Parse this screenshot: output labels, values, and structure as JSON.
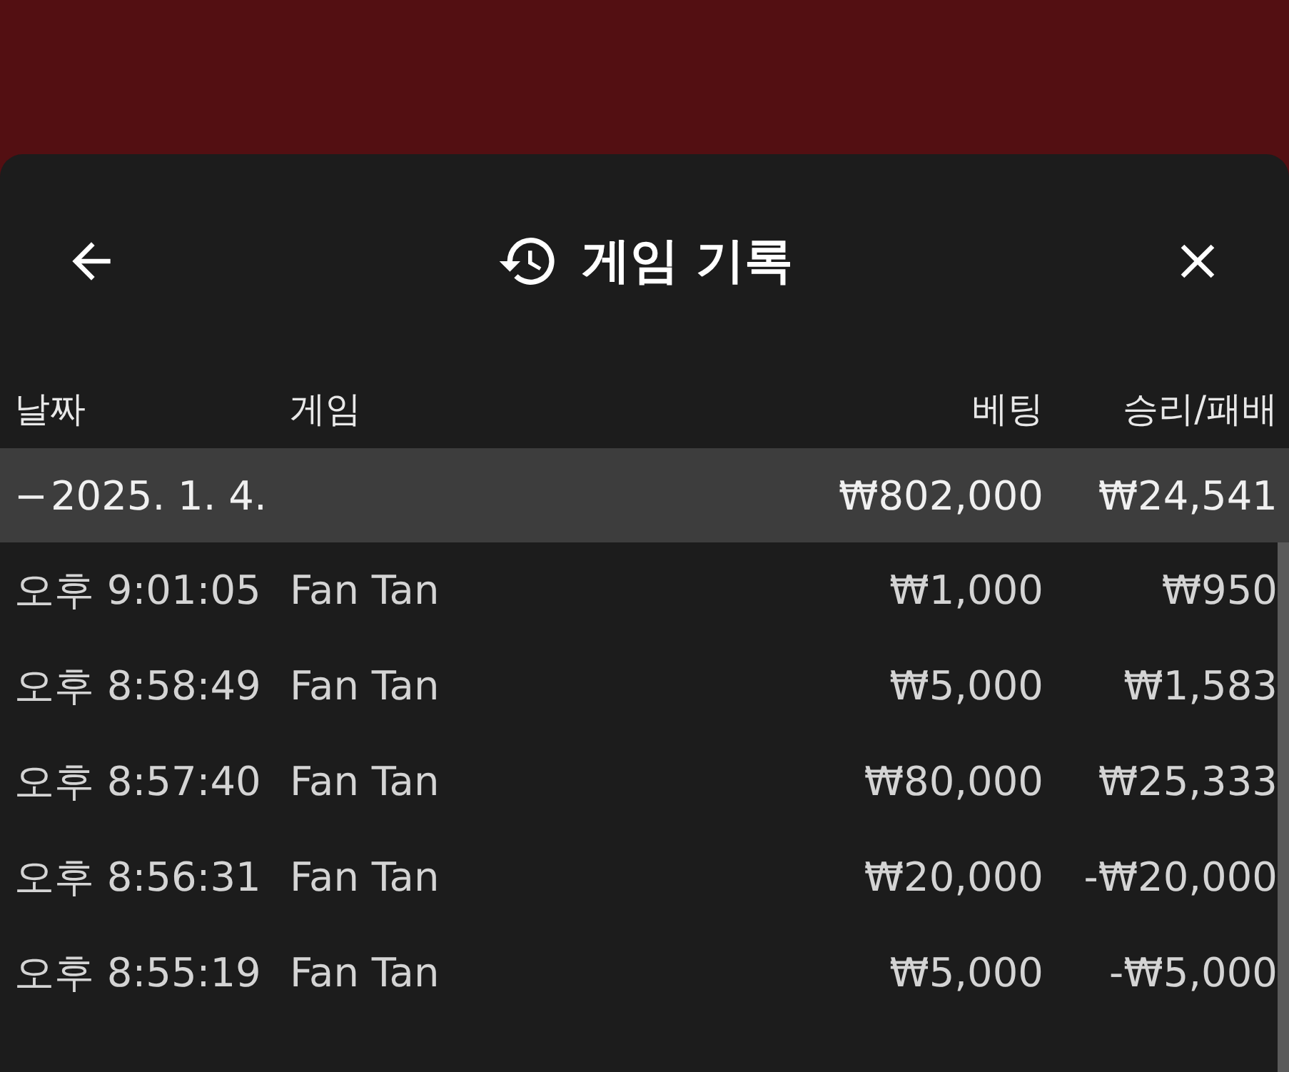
{
  "header": {
    "title": "게임 기록"
  },
  "table": {
    "columns": [
      "날짜",
      "게임",
      "베팅",
      "승리/패배"
    ],
    "group": {
      "expander": "−",
      "date": "2025. 1. 4.",
      "bet": "₩802,000",
      "result": "₩24,541"
    },
    "rows": [
      {
        "time": "오후 9:01:05",
        "game": "Fan Tan",
        "bet": "₩1,000",
        "result": "₩950"
      },
      {
        "time": "오후 8:58:49",
        "game": "Fan Tan",
        "bet": "₩5,000",
        "result": "₩1,583"
      },
      {
        "time": "오후 8:57:40",
        "game": "Fan Tan",
        "bet": "₩80,000",
        "result": "₩25,333"
      },
      {
        "time": "오후 8:56:31",
        "game": "Fan Tan",
        "bet": "₩20,000",
        "result": "-₩20,000"
      },
      {
        "time": "오후 8:55:19",
        "game": "Fan Tan",
        "bet": "₩5,000",
        "result": "-₩5,000"
      }
    ]
  }
}
